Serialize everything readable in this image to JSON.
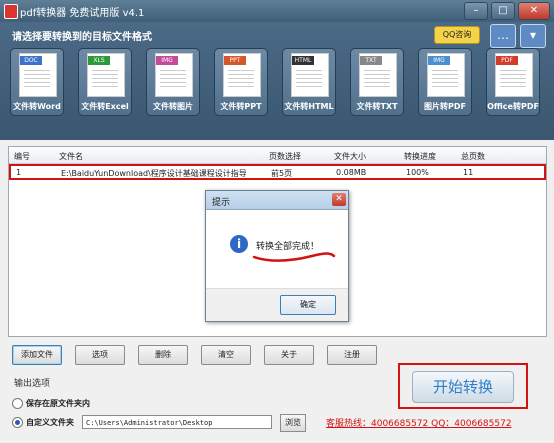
{
  "window": {
    "title": "pdf转换器 免费试用版 v4.1",
    "min": "–",
    "max": "□",
    "close": "✕"
  },
  "header": {
    "prompt": "请选择要转换到的目标文件格式",
    "qq_label": "QQ咨询",
    "skin_icon": "shirt-icon",
    "menu_icon": "menu-icon"
  },
  "formats": [
    {
      "tag": "DOC",
      "label": "文件转Word",
      "color": "#3d74c9",
      "icon": "word-doc-icon"
    },
    {
      "tag": "XLS",
      "label": "文件转Excel",
      "color": "#2d9a3a",
      "icon": "excel-doc-icon"
    },
    {
      "tag": "IMG",
      "label": "文件转图片",
      "color": "#c24b9b",
      "icon": "image-doc-icon"
    },
    {
      "tag": "PPT",
      "label": "文件转PPT",
      "color": "#d2572c",
      "icon": "ppt-doc-icon"
    },
    {
      "tag": "HTML",
      "label": "文件转HTML",
      "color": "#333333",
      "icon": "html-doc-icon"
    },
    {
      "tag": "TXT",
      "label": "文件转TXT",
      "color": "#888888",
      "icon": "txt-doc-icon"
    },
    {
      "tag": "IMG",
      "label": "图片转PDF",
      "color": "#4a8fd0",
      "icon": "image-to-pdf-icon"
    },
    {
      "tag": "PDF",
      "label": "Office转PDF",
      "color": "#d33b2b",
      "icon": "office-to-pdf-icon"
    }
  ],
  "table": {
    "columns": [
      "编号",
      "文件名",
      "页数选择",
      "文件大小",
      "转换进度",
      "总页数"
    ],
    "rows": [
      {
        "no": "1",
        "file": "E:\\BaiduYunDownload\\程序设计基础课程设计指导",
        "pages": "前5页",
        "size": "0.08MB",
        "progress": "100%",
        "total": "11"
      }
    ]
  },
  "dialog": {
    "title": "提示",
    "message": "转换全部完成！",
    "ok": "确定",
    "close": "✕"
  },
  "buttons": [
    "添加文件",
    "选项",
    "删除",
    "清空",
    "关于",
    "注册"
  ],
  "output": {
    "label": "输出选项",
    "opt1": "保存在原文件夹内",
    "opt2": "自定义文件夹",
    "path": "C:\\Users\\Administrator\\Desktop",
    "browse": "浏览",
    "selected": "opt2"
  },
  "start": "开始转换",
  "hotline": "客服热线：4006685572 QQ：4006685572",
  "colors": {
    "highlight": "#d31212",
    "accent": "#2e7fc7",
    "header": "#3d5a75"
  }
}
